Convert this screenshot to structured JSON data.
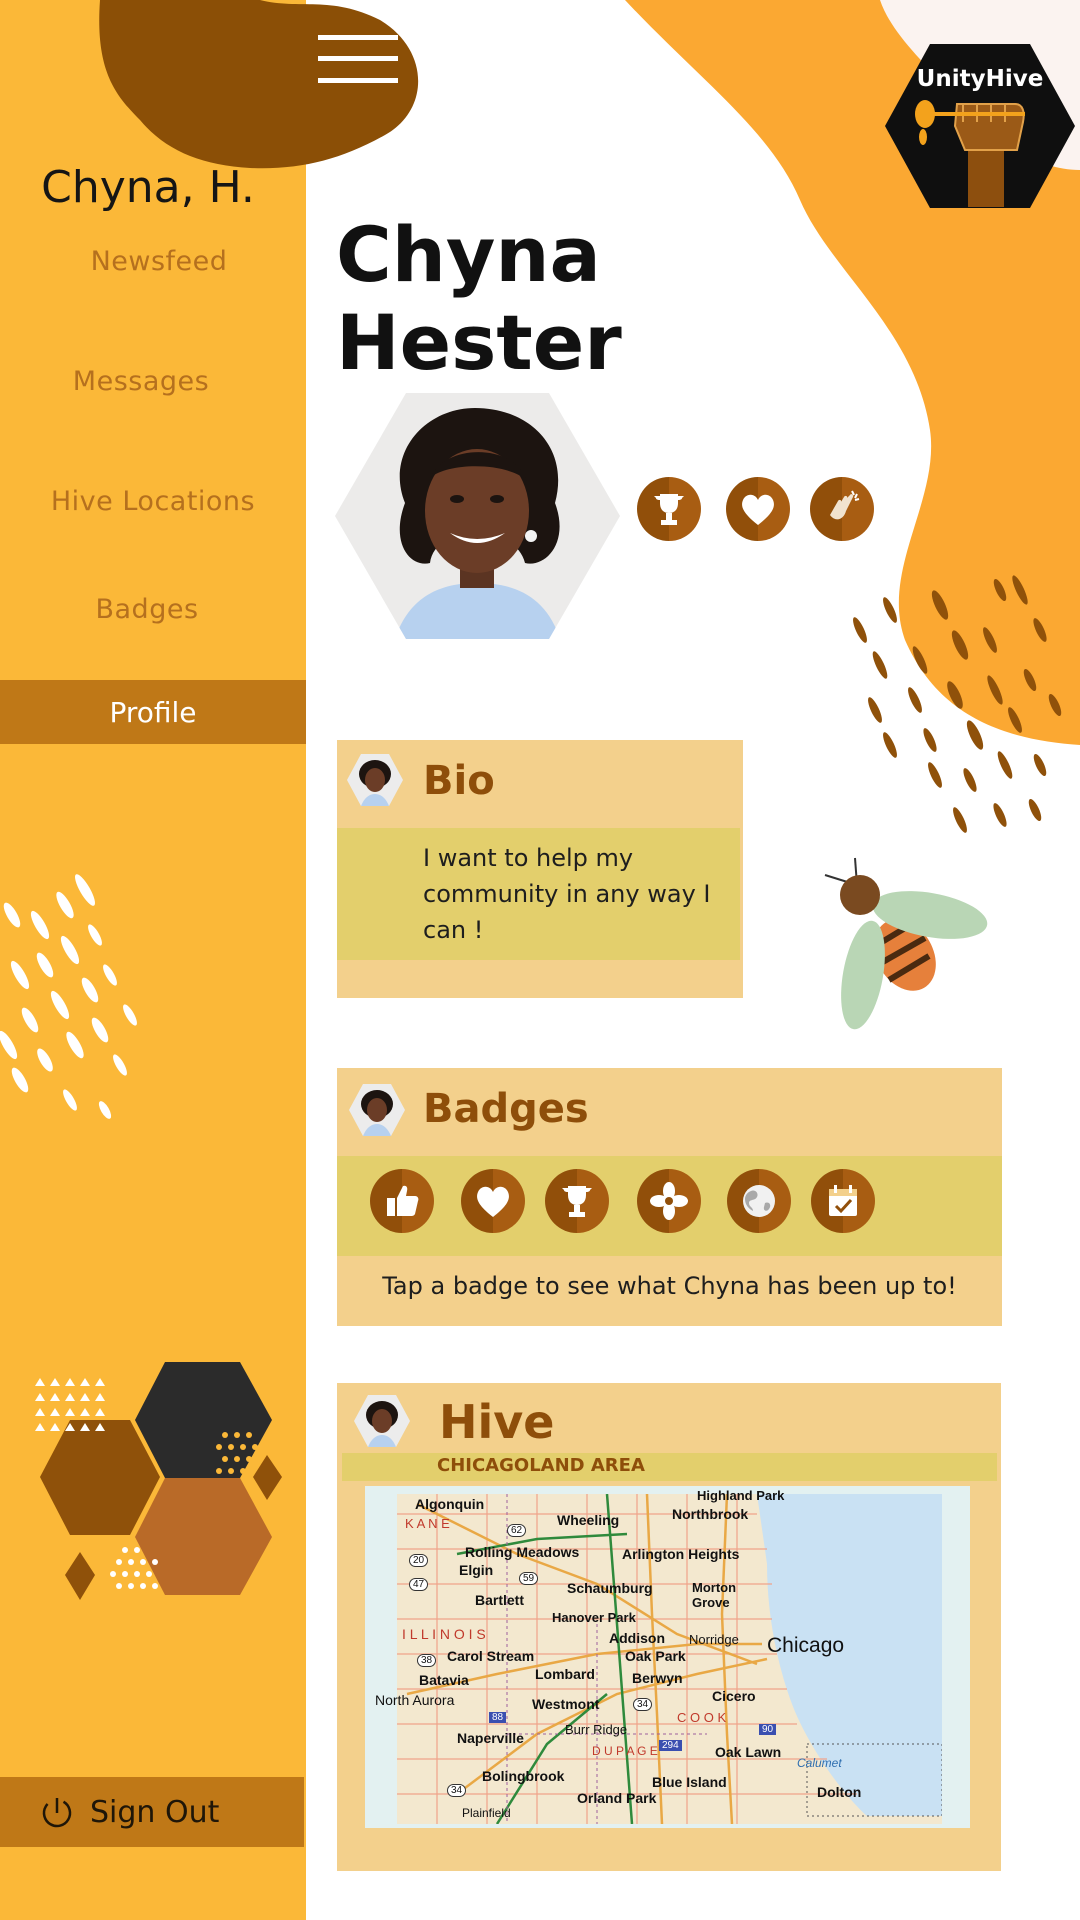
{
  "app": {
    "brand": "UnityHive"
  },
  "sidebar": {
    "user_short": "Chyna, H.",
    "items": [
      {
        "label": "Newsfeed"
      },
      {
        "label": "Messages"
      },
      {
        "label": "Hive Locations"
      },
      {
        "label": "Badges"
      },
      {
        "label": "Profile",
        "active": true
      }
    ],
    "signout_label": "Sign Out"
  },
  "profile": {
    "first_name": "Chyna",
    "last_name": "Hester",
    "top_badges": [
      "trophy-icon",
      "heart-icon",
      "clapping-hands-icon"
    ]
  },
  "bio": {
    "title": "Bio",
    "text": "I want to help my community in any way I can !"
  },
  "badges": {
    "title": "Badges",
    "items": [
      "thumbs-up-icon",
      "heart-icon",
      "trophy-icon",
      "flower-icon",
      "globe-icon",
      "calendar-check-icon"
    ],
    "hint": "Tap a badge to see what Chyna has been up to!"
  },
  "hive": {
    "title": "Hive",
    "area": "CHICAGOLAND AREA",
    "map_labels": {
      "algonquin": "Algonquin",
      "highland_park": "Highland Park",
      "wheeling": "Wheeling",
      "northbrook": "Northbrook",
      "kane": "K A N E",
      "rolling_meadows": "Rolling Meadows",
      "arlington_heights": "Arlington Heights",
      "elgin": "Elgin",
      "schaumburg": "Schaumburg",
      "morton_grove": "Morton Grove",
      "bartlett": "Bartlett",
      "hanover_park": "Hanover Park",
      "illinois": "I L L I N O I S",
      "addison": "Addison",
      "norridge": "Norridge",
      "chicago": "Chicago",
      "carol_stream": "Carol Stream",
      "oak_park": "Oak Park",
      "batavia": "Batavia",
      "lombard": "Lombard",
      "berwyn": "Berwyn",
      "aurora": "North Aurora",
      "cicero": "Cicero",
      "westmont": "Westmont",
      "cook": "C O O K",
      "naperville": "Naperville",
      "burr_ridge": "Burr Ridge",
      "dupage": "D U P A G E",
      "oak_lawn": "Oak Lawn",
      "calumet": "Calumet",
      "bolingbrook": "Bolingbrook",
      "blue_island": "Blue Island",
      "orland_park": "Orland Park",
      "dolton": "Dolton",
      "plainfield": "Plainfield",
      "r62": "62",
      "r20": "20",
      "r47": "47",
      "r59": "59",
      "r38": "38",
      "r34": "34",
      "r88": "88",
      "r294": "294",
      "r90": "90",
      "r34b": "34"
    }
  },
  "colors": {
    "sidebar": "#fbb838",
    "sidebar_active": "#bf7817",
    "nav_text": "#b5701e",
    "card": "#f3d08c",
    "card_band": "#e3cf6c",
    "card_title": "#8e4e0a",
    "blob_dark": "#8b4f06",
    "blob_orange": "#fba832"
  }
}
